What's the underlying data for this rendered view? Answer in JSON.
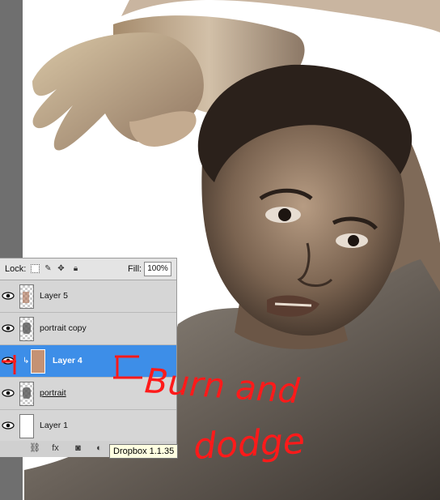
{
  "layers_panel": {
    "lock_label": "Lock:",
    "fill_label": "Fill:",
    "fill_value": "100%",
    "layers": [
      {
        "name": "Layer 5",
        "visible": true,
        "selected": false,
        "thumb": "checker-brown"
      },
      {
        "name": "portrait copy",
        "visible": true,
        "selected": false,
        "thumb": "checker-portrait"
      },
      {
        "name": "Layer 4",
        "visible": true,
        "selected": true,
        "thumb": "brown-fill",
        "clipped": true
      },
      {
        "name": "portrait",
        "visible": true,
        "selected": false,
        "thumb": "checker-portrait",
        "underlined": true
      },
      {
        "name": "Layer 1",
        "visible": true,
        "selected": false,
        "thumb": "white"
      }
    ],
    "bottom_icons": [
      "link-icon",
      "fx-icon",
      "mask-icon",
      "adjustment-icon"
    ]
  },
  "tooltip": "Dropbox 1.1.35",
  "annotation": {
    "text_line1": "Burn and",
    "text_line2": "dodge",
    "color": "#ff1a1a"
  },
  "colors": {
    "selected_row": "#3d8ee8",
    "panel_bg": "#d6d6d6",
    "skin_dark": "#5a4636",
    "skin_light": "#cfb9a0"
  }
}
